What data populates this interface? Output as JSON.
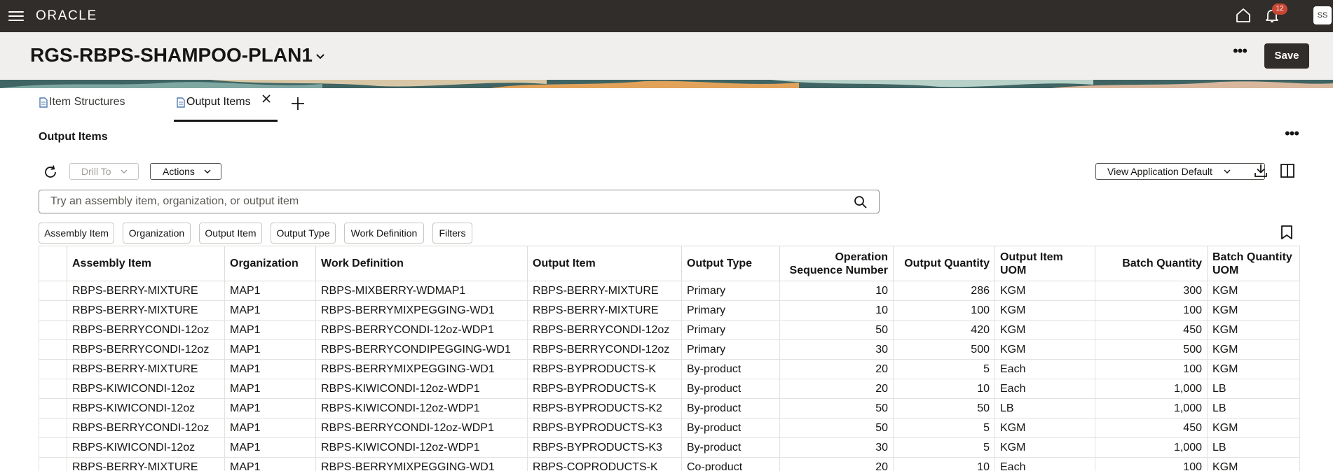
{
  "topbar": {
    "logo": "ORACLE",
    "notification_count": "12",
    "user_initials": "SS"
  },
  "header": {
    "title": "RGS-RBPS-SHAMPOO-PLAN1",
    "save_label": "Save"
  },
  "tabs": [
    {
      "label": "Item Structures",
      "active": false
    },
    {
      "label": "Output Items",
      "active": true
    }
  ],
  "section": {
    "title": "Output Items"
  },
  "toolbar": {
    "drill_to_label": "Drill To",
    "actions_label": "Actions",
    "view_label": "View Application Default"
  },
  "search": {
    "placeholder": "Try an assembly item, organization, or output item"
  },
  "filter_chips": [
    "Assembly Item",
    "Organization",
    "Output Item",
    "Output Type",
    "Work Definition",
    "Filters"
  ],
  "table": {
    "columns": [
      "Assembly Item",
      "Organization",
      "Work Definition",
      "Output Item",
      "Output Type",
      "Operation Sequence Number",
      "Output Quantity",
      "Output Item UOM",
      "Batch Quantity",
      "Batch Quantity UOM"
    ],
    "rows": [
      [
        "RBPS-BERRY-MIXTURE",
        "MAP1",
        "RBPS-MIXBERRY-WDMAP1",
        "RBPS-BERRY-MIXTURE",
        "Primary",
        "10",
        "286",
        "KGM",
        "300",
        "KGM"
      ],
      [
        "RBPS-BERRY-MIXTURE",
        "MAP1",
        "RBPS-BERRYMIXPEGGING-WD1",
        "RBPS-BERRY-MIXTURE",
        "Primary",
        "10",
        "100",
        "KGM",
        "100",
        "KGM"
      ],
      [
        "RBPS-BERRYCONDI-12oz",
        "MAP1",
        "RBPS-BERRYCONDI-12oz-WDP1",
        "RBPS-BERRYCONDI-12oz",
        "Primary",
        "50",
        "420",
        "KGM",
        "450",
        "KGM"
      ],
      [
        "RBPS-BERRYCONDI-12oz",
        "MAP1",
        "RBPS-BERRYCONDIPEGGING-WD1",
        "RBPS-BERRYCONDI-12oz",
        "Primary",
        "30",
        "500",
        "KGM",
        "500",
        "KGM"
      ],
      [
        "RBPS-BERRY-MIXTURE",
        "MAP1",
        "RBPS-BERRYMIXPEGGING-WD1",
        "RBPS-BYPRODUCTS-K",
        "By-product",
        "20",
        "5",
        "Each",
        "100",
        "KGM"
      ],
      [
        "RBPS-KIWICONDI-12oz",
        "MAP1",
        "RBPS-KIWICONDI-12oz-WDP1",
        "RBPS-BYPRODUCTS-K",
        "By-product",
        "20",
        "10",
        "Each",
        "1,000",
        "LB"
      ],
      [
        "RBPS-KIWICONDI-12oz",
        "MAP1",
        "RBPS-KIWICONDI-12oz-WDP1",
        "RBPS-BYPRODUCTS-K2",
        "By-product",
        "50",
        "50",
        "LB",
        "1,000",
        "LB"
      ],
      [
        "RBPS-BERRYCONDI-12oz",
        "MAP1",
        "RBPS-BERRYCONDI-12oz-WDP1",
        "RBPS-BYPRODUCTS-K3",
        "By-product",
        "50",
        "5",
        "KGM",
        "450",
        "KGM"
      ],
      [
        "RBPS-KIWICONDI-12oz",
        "MAP1",
        "RBPS-KIWICONDI-12oz-WDP1",
        "RBPS-BYPRODUCTS-K3",
        "By-product",
        "30",
        "5",
        "KGM",
        "1,000",
        "LB"
      ],
      [
        "RBPS-BERRY-MIXTURE",
        "MAP1",
        "RBPS-BERRYMIXPEGGING-WD1",
        "RBPS-COPRODUCTS-K",
        "Co-product",
        "20",
        "10",
        "Each",
        "100",
        "KGM"
      ]
    ]
  },
  "colors": {
    "topbar_bg": "#312d2a",
    "header_bg": "#f1efed",
    "badge": "#c74634",
    "save_bg": "#312d2a"
  }
}
